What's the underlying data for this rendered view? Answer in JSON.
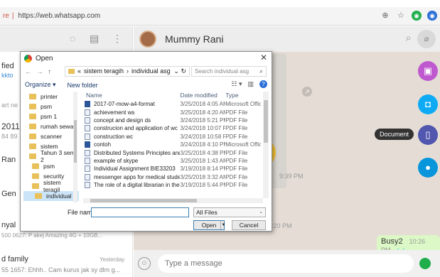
{
  "browser": {
    "url_prefix": "re",
    "url": "https://web.whatsapp.com"
  },
  "left_panel": {
    "fragments": [
      "fied",
      "kkto",
      "art ne",
      "2011",
      "84 89",
      "Ran",
      "Gen",
      "nyal",
      "500 0627: P akej Amazing 4G + 10GB..."
    ],
    "last_chat": {
      "name": "d family",
      "time": "Yesterday",
      "preview": "55 1657: Ehhh.. Cam kurus jak sy dlm g..."
    }
  },
  "chat": {
    "contact_name": "Mummy Rani",
    "times": [
      "9:39 PM",
      "0:20 PM"
    ],
    "out_message": "Busy2",
    "out_time": "10:26 PM",
    "input_placeholder": "Type a message",
    "tooltip": "Document",
    "attach_colors": [
      "#bf59cf",
      "#0eabf4",
      "#5157ae",
      "#0795dc"
    ]
  },
  "dialog": {
    "title": "Open",
    "path": [
      "sistem teragih",
      "individual asg"
    ],
    "search_placeholder": "Search individual asg",
    "toolbar": {
      "organize": "Organize ▾",
      "new_folder": "New folder"
    },
    "nav_items": [
      "printer",
      "psm",
      "psm 1",
      "rumah sewa",
      "scanner",
      "sistem",
      "Tahun 3 sem 2",
      "psm",
      "security",
      "sistem teragil",
      "individual a"
    ],
    "columns": {
      "name": "Name",
      "date": "Date modified",
      "type": "Type"
    },
    "files": [
      {
        "name": "2017-07-mow-a4-format",
        "date": "3/25/2018 4:05 AM",
        "type": "Microsoft Office...",
        "icon": "word-icon"
      },
      {
        "name": "achievement ws",
        "date": "3/25/2018 4:20 AM",
        "type": "PDF File",
        "icon": "pdf-icon"
      },
      {
        "name": "concept and design ds",
        "date": "3/24/2018 5:21 PM",
        "type": "PDF File",
        "icon": "pdf-icon"
      },
      {
        "name": "construcion and application of wc",
        "date": "3/24/2018 10:07 PM",
        "type": "PDF File",
        "icon": "pdf-icon"
      },
      {
        "name": "construction wc",
        "date": "3/24/2018 10:58 PM",
        "type": "PDF File",
        "icon": "pdf-icon"
      },
      {
        "name": "contoh",
        "date": "3/24/2018 4:10 PM",
        "type": "Microsoft Office...",
        "icon": "word-icon"
      },
      {
        "name": "Distributed Systems Principles and Paradi...",
        "date": "3/25/2018 4:38 PM",
        "type": "PDF File",
        "icon": "pdf-icon"
      },
      {
        "name": "example of skype",
        "date": "3/25/2018 1:43 AM",
        "type": "PDF File",
        "icon": "pdf-icon"
      },
      {
        "name": "Individual Assignment BIE33203",
        "date": "3/19/2018 8:14 PM",
        "type": "PDF File",
        "icon": "pdf-icon"
      },
      {
        "name": "messenger apps for medical student",
        "date": "3/25/2018 3:32 AM",
        "type": "PDF File",
        "icon": "pdf-icon"
      },
      {
        "name": "The role of a digital librarian in the mana...",
        "date": "3/19/2018 5:44 PM",
        "type": "PDF File",
        "icon": "pdf-icon"
      }
    ],
    "file_name_label": "File name:",
    "file_name_value": "",
    "filter": "All Files",
    "open_label": "Open",
    "cancel_label": "Cancel"
  }
}
